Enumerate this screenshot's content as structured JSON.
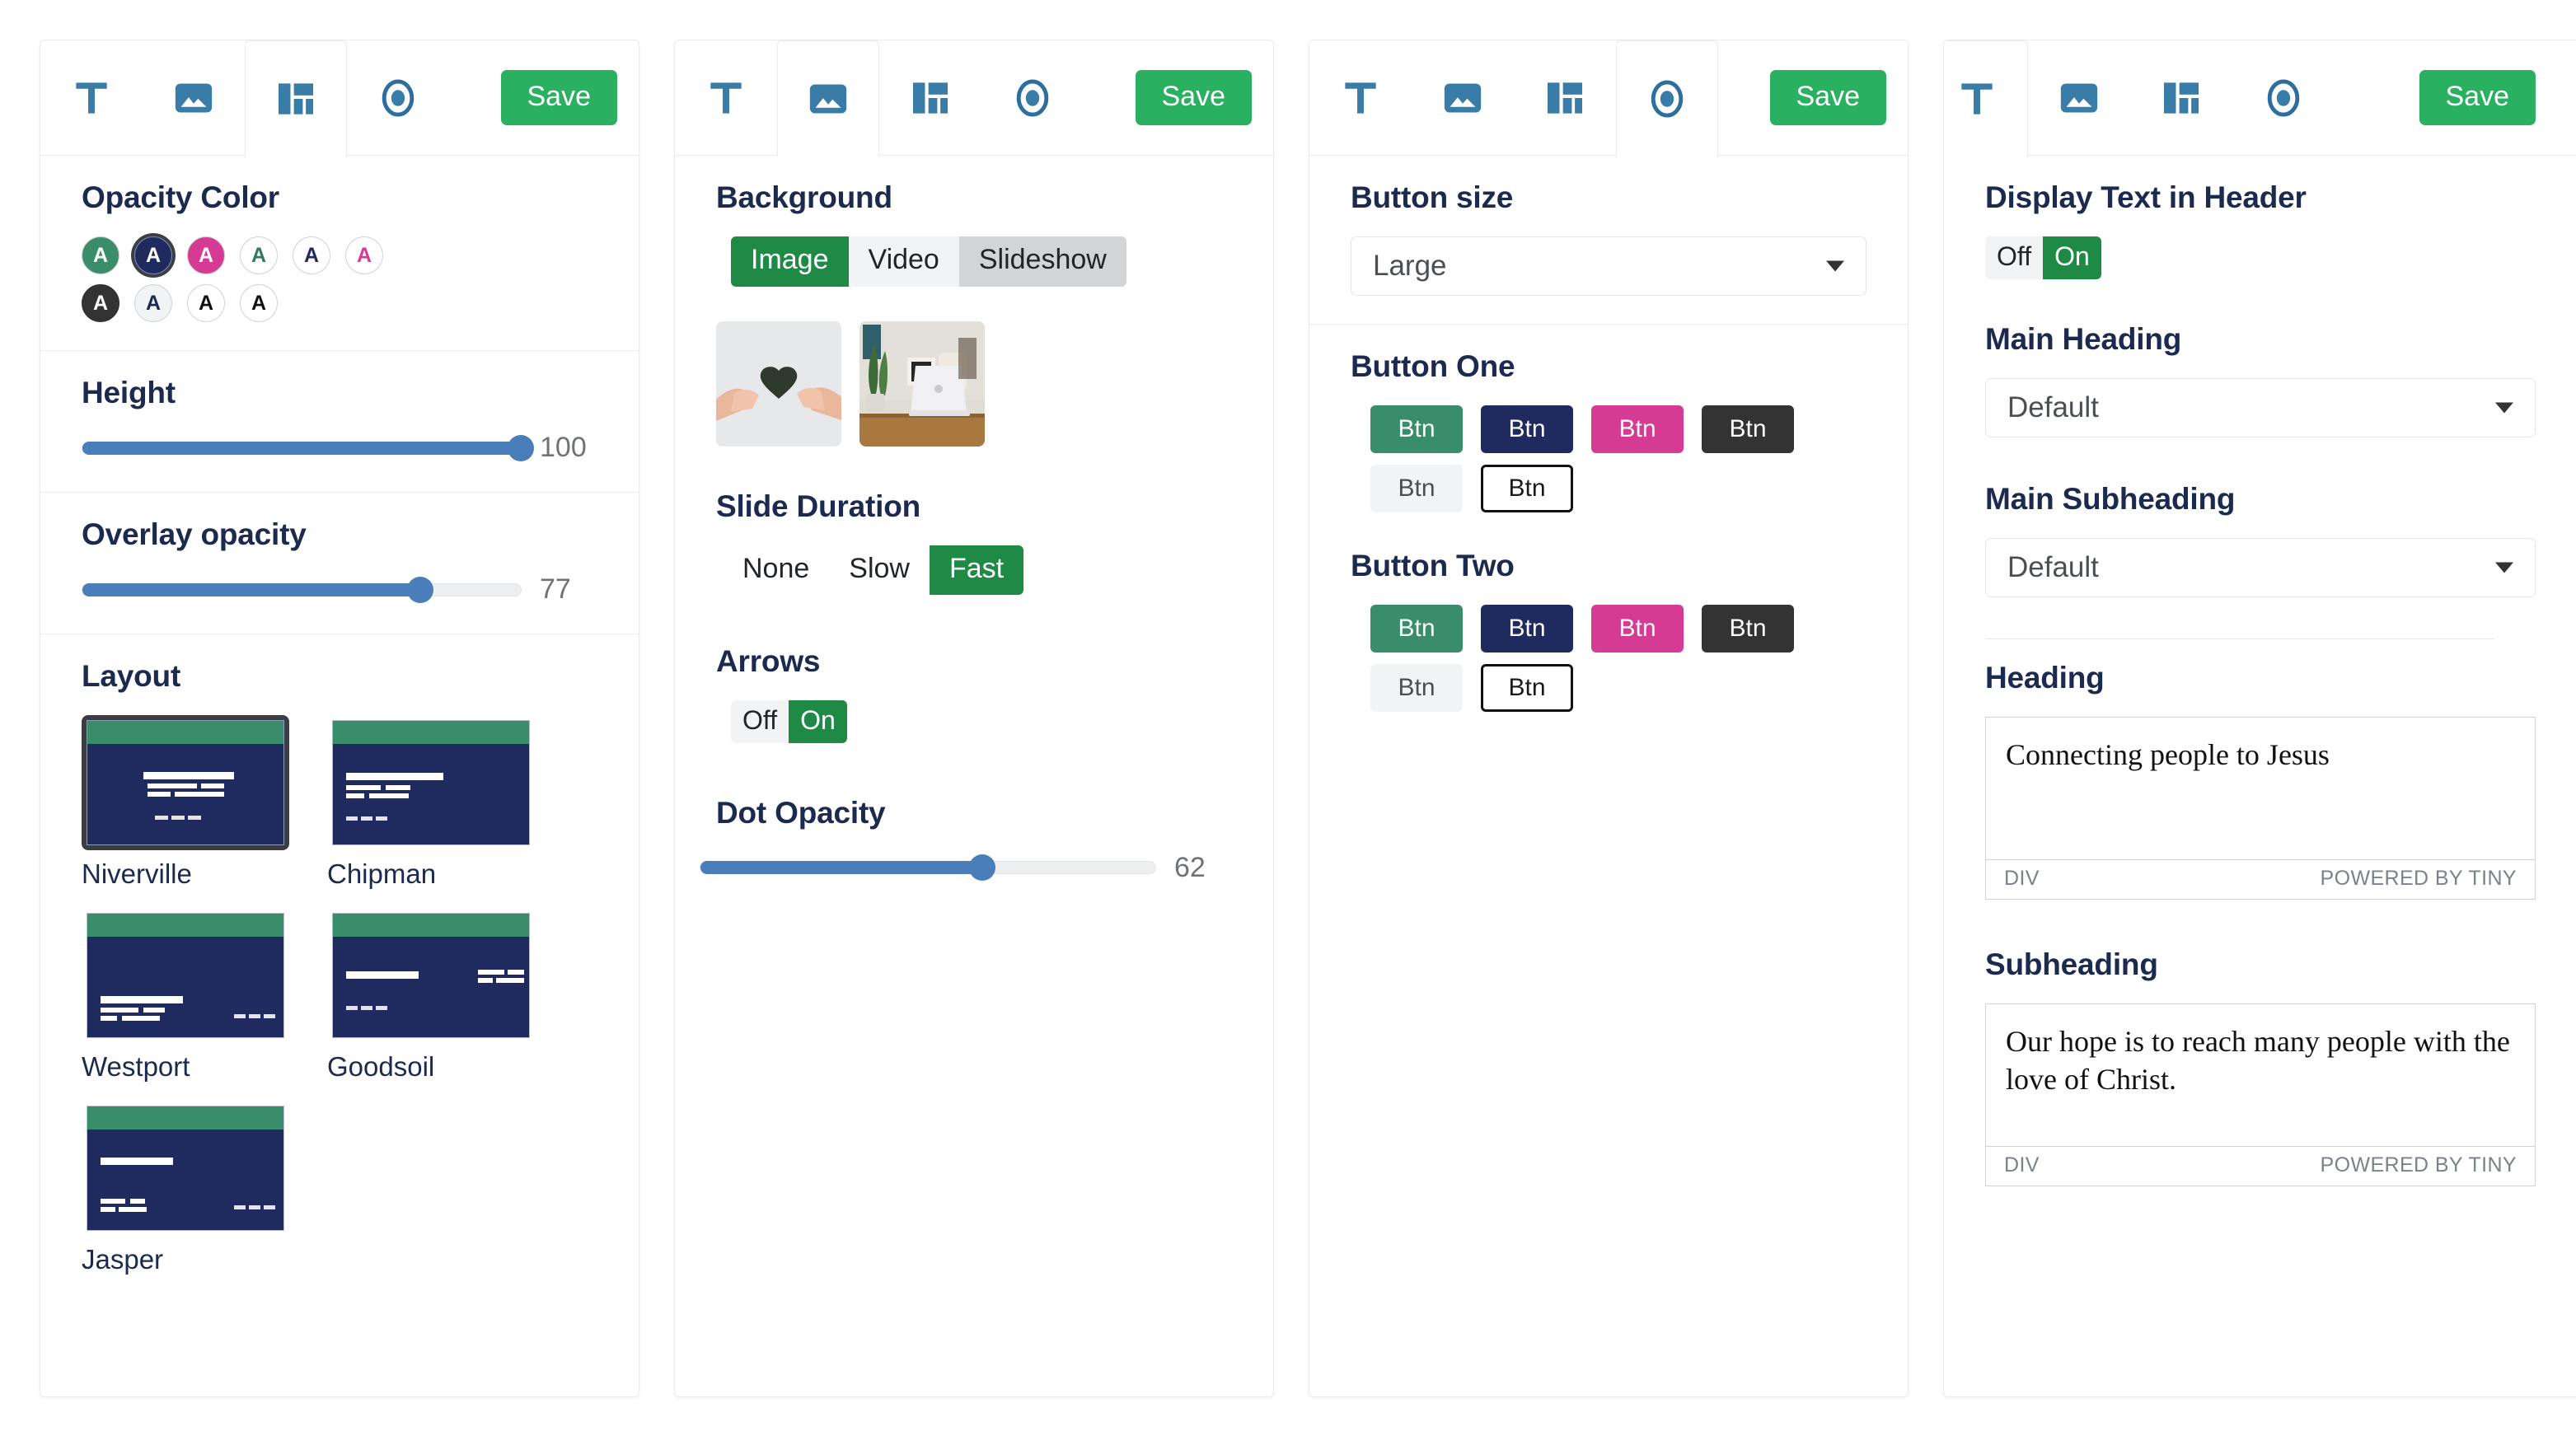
{
  "tabs": {
    "items": [
      {
        "icon": "text-tab-icon",
        "name": "text"
      },
      {
        "icon": "image-tab-icon",
        "name": "image"
      },
      {
        "icon": "layout-tab-icon",
        "name": "layout"
      },
      {
        "icon": "circle-tab-icon",
        "name": "button"
      }
    ],
    "save_label": "Save"
  },
  "colors": {
    "green": "#398d6b",
    "navy": "#1f2a5e",
    "pink": "#d63b93",
    "dark": "#333333",
    "light": "#f1f3f4",
    "white": "#ffffff",
    "accent_blue": "#4a7ebb",
    "save_green": "#2ab061",
    "toggle_green": "#1e8a45",
    "heading_navy": "#1b2a4e"
  },
  "panel1": {
    "active_tab": 2,
    "opacity_color": {
      "title": "Opacity Color",
      "letter": "A",
      "selected_index": 1,
      "swatches": [
        {
          "bg": "#398d6b",
          "fg": "#ffffff",
          "border": "#c9cdd3"
        },
        {
          "bg": "#1f2a5e",
          "fg": "#ffffff",
          "border": "#7d89b5"
        },
        {
          "bg": "#d63b93",
          "fg": "#ffffff",
          "border": "#c9cdd3"
        },
        {
          "bg": "#ffffff",
          "fg": "#2f7a5c",
          "border": "#b9bec5"
        },
        {
          "bg": "#ffffff",
          "fg": "#1f2a5e",
          "border": "#b9bec5"
        },
        {
          "bg": "#ffffff",
          "fg": "#d63b93",
          "border": "#b9bec5"
        },
        {
          "bg": "#333333",
          "fg": "#ffffff",
          "border": "#333333"
        },
        {
          "bg": "#f1f3f4",
          "fg": "#1b2a4e",
          "border": "#c9cdd3"
        },
        {
          "bg": "#ffffff",
          "fg": "#111111",
          "border": "#b9bec5"
        },
        {
          "bg": "#ffffff",
          "fg": "#111111",
          "border": "#b9bec5"
        }
      ]
    },
    "height": {
      "title": "Height",
      "value": "100",
      "percent": 100
    },
    "overlay_opacity": {
      "title": "Overlay opacity",
      "value": "77",
      "percent": 77
    },
    "layout": {
      "title": "Layout",
      "selected_index": 0,
      "items": [
        {
          "label": "Niverville",
          "variant": "center"
        },
        {
          "label": "Chipman",
          "variant": "top-left"
        },
        {
          "label": "Westport",
          "variant": "bottom-left"
        },
        {
          "label": "Goodsoil",
          "variant": "split"
        },
        {
          "label": "Jasper",
          "variant": "stacked-left"
        }
      ]
    }
  },
  "panel2": {
    "active_tab": 1,
    "background": {
      "title": "Background",
      "options": [
        "Image",
        "Video",
        "Slideshow"
      ],
      "selected": "Image",
      "hovered": "Slideshow"
    },
    "images": [
      {
        "alt": "hands-holding-paper-heart"
      },
      {
        "alt": "laptop-on-desk-with-plant"
      }
    ],
    "slide_duration": {
      "title": "Slide Duration",
      "options": [
        "None",
        "Slow",
        "Fast"
      ],
      "selected": "Fast"
    },
    "arrows": {
      "title": "Arrows",
      "options": [
        "Off",
        "On"
      ],
      "selected": "On"
    },
    "dot_opacity": {
      "title": "Dot Opacity",
      "value": "62",
      "percent": 62
    }
  },
  "panel3": {
    "active_tab": 3,
    "button_size": {
      "title": "Button size",
      "value": "Large"
    },
    "button_one": {
      "title": "Button One",
      "selected_index": 5,
      "label": "Btn",
      "variants": [
        {
          "bg": "#398d6b",
          "style": "solid"
        },
        {
          "bg": "#1f2a5e",
          "style": "solid"
        },
        {
          "bg": "#d63b93",
          "style": "solid"
        },
        {
          "bg": "#333333",
          "style": "solid"
        },
        {
          "bg": "#f1f3f4",
          "style": "light"
        },
        {
          "bg": "#ffffff",
          "style": "outline"
        }
      ]
    },
    "button_two": {
      "title": "Button Two",
      "selected_index": 5,
      "label": "Btn",
      "variants": [
        {
          "bg": "#398d6b",
          "style": "solid"
        },
        {
          "bg": "#1f2a5e",
          "style": "solid"
        },
        {
          "bg": "#d63b93",
          "style": "solid"
        },
        {
          "bg": "#333333",
          "style": "solid"
        },
        {
          "bg": "#f1f3f4",
          "style": "light"
        },
        {
          "bg": "#ffffff",
          "style": "outline"
        }
      ]
    }
  },
  "panel4": {
    "active_tab": 0,
    "display_text": {
      "title": "Display Text in Header",
      "options": [
        "Off",
        "On"
      ],
      "selected": "On"
    },
    "main_heading": {
      "title": "Main Heading",
      "value": "Default"
    },
    "main_subheading": {
      "title": "Main Subheading",
      "value": "Default"
    },
    "heading_editor": {
      "title": "Heading",
      "content": "Connecting people to Jesus",
      "status_left": "DIV",
      "status_right": "POWERED BY TINY"
    },
    "subheading_editor": {
      "title": "Subheading",
      "content": "Our hope is to reach many people with the love of Christ.",
      "status_left": "DIV",
      "status_right": "POWERED BY TINY"
    }
  }
}
